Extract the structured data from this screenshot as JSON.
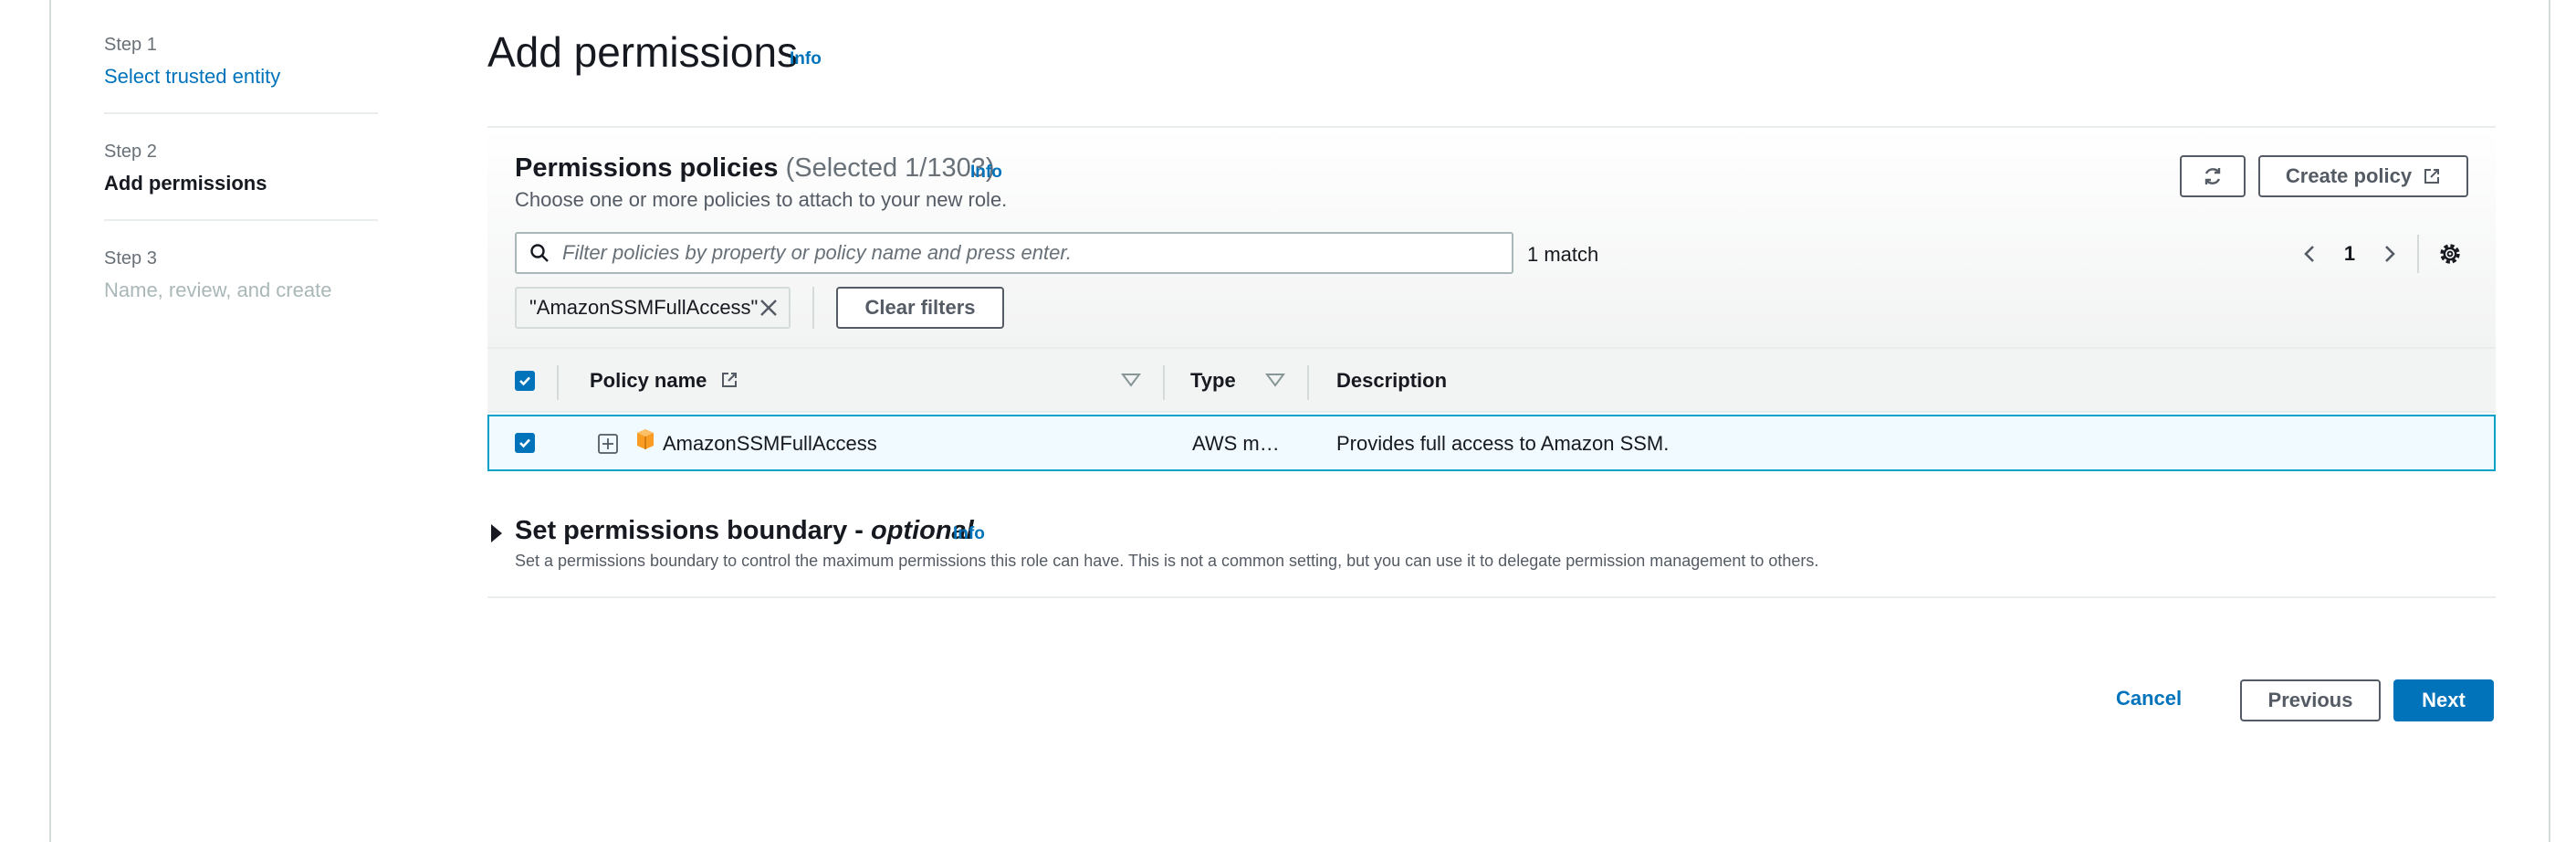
{
  "steps": [
    {
      "number": "Step 1",
      "title": "Select trusted entity"
    },
    {
      "number": "Step 2",
      "title": "Add permissions"
    },
    {
      "number": "Step 3",
      "title": "Name, review, and create"
    }
  ],
  "header": {
    "title": "Add permissions",
    "info": "Info"
  },
  "policies": {
    "title": "Permissions policies",
    "selected": "(Selected 1/1303)",
    "info": "Info",
    "description": "Choose one or more policies to attach to your new role.",
    "create_label": "Create policy",
    "filter_placeholder": "Filter policies by property or policy name and press enter.",
    "match_text": "1 match",
    "page": "1",
    "filter_token": "\"AmazonSSMFullAccess\"",
    "clear_label": "Clear filters",
    "columns": {
      "name": "Policy name",
      "type": "Type",
      "description": "Description"
    },
    "rows": [
      {
        "name": "AmazonSSMFullAccess",
        "type": "AWS m…",
        "description": "Provides full access to Amazon SSM.",
        "selected": true
      }
    ]
  },
  "boundary": {
    "title": "Set permissions boundary -",
    "optional": "optional",
    "info": "Info",
    "description": "Set a permissions boundary to control the maximum permissions this role can have. This is not a common setting, but you can use it to delegate permission management to others."
  },
  "footer": {
    "cancel": "Cancel",
    "previous": "Previous",
    "next": "Next"
  },
  "colors": {
    "link": "#0073bb",
    "primary": "#0073bb",
    "selected_row_bg": "#f1faff",
    "selected_row_border": "#00a1c9",
    "policy_icon": "#f89c24"
  },
  "icons": [
    "search-icon",
    "refresh-icon",
    "external-link-icon",
    "chevron-left-icon",
    "chevron-right-icon",
    "gear-icon",
    "close-icon",
    "sort-icon",
    "expand-icon",
    "aws-policy-icon",
    "caret-right-icon",
    "checkbox-checked-icon"
  ]
}
